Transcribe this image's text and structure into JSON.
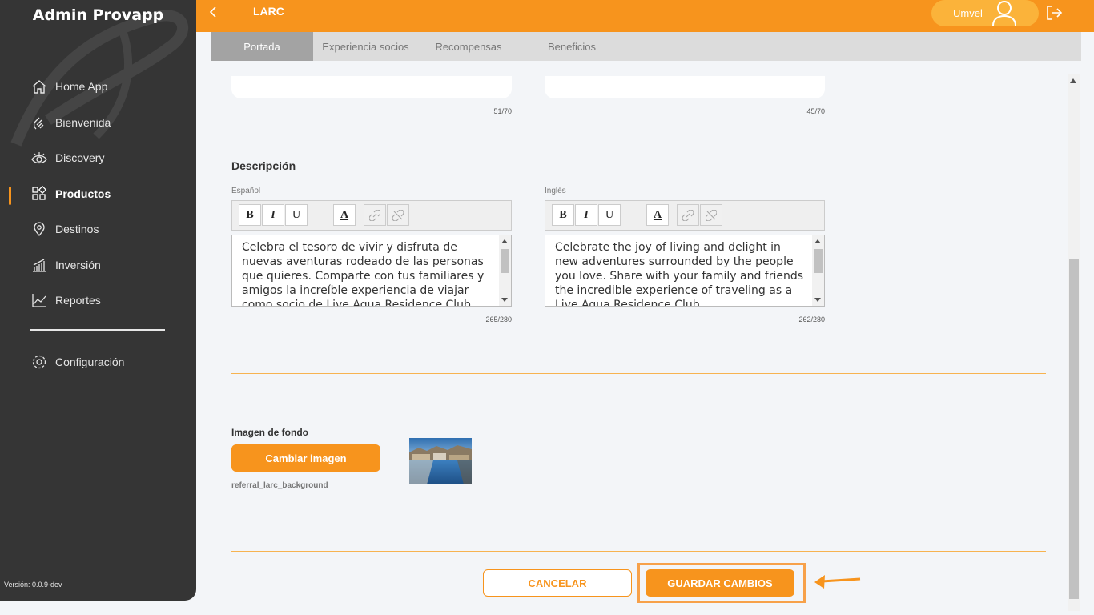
{
  "app": {
    "title": "Admin Provapp",
    "version": "Versión: 0.0.9-dev"
  },
  "sidebar": {
    "items": [
      {
        "label": "Home App",
        "icon": "home-icon"
      },
      {
        "label": "Bienvenida",
        "icon": "wave-hand-icon"
      },
      {
        "label": "Discovery",
        "icon": "eye-icon"
      },
      {
        "label": "Productos",
        "icon": "grid-icon",
        "active": true
      },
      {
        "label": "Destinos",
        "icon": "location-pin-icon"
      },
      {
        "label": "Inversión",
        "icon": "bar-chart-icon"
      },
      {
        "label": "Reportes",
        "icon": "line-chart-icon"
      }
    ],
    "settings": {
      "label": "Configuración",
      "icon": "gear-icon"
    }
  },
  "header": {
    "title": "LARC",
    "user": "Umvel"
  },
  "tabs": [
    {
      "label": "Portada",
      "active": true
    },
    {
      "label": "Experiencia socios"
    },
    {
      "label": "Recompensas"
    },
    {
      "label": "Beneficios"
    }
  ],
  "title_fields": {
    "es_count": "51/70",
    "en_count": "45/70"
  },
  "description": {
    "title": "Descripción",
    "es": {
      "label": "Español",
      "text": "Celebra el tesoro de vivir y disfruta de nuevas aventuras rodeado de las personas que quieres. Comparte con tus familiares y amigos la increíble experiencia de viajar como socio de Live Aqua Residence Club.",
      "count": "265/280"
    },
    "en": {
      "label": "Inglés",
      "text": "Celebrate the joy of living and delight in new adventures surrounded by the people you love. Share with your family and friends the incredible experience of traveling as a Live Aqua Residence Club.",
      "count": "262/280"
    },
    "toolbar": {
      "bold": "B",
      "italic": "I",
      "underline": "U",
      "color": "A"
    }
  },
  "background_image": {
    "label": "Imagen de fondo",
    "button": "Cambiar imagen",
    "filename": "referral_larc_background"
  },
  "actions": {
    "cancel": "CANCELAR",
    "save": "GUARDAR CAMBIOS"
  },
  "colors": {
    "accent": "#f7941d",
    "sidebar": "#353535",
    "tabs": "#dcdcdc",
    "tab_active": "#a3a3a3"
  }
}
